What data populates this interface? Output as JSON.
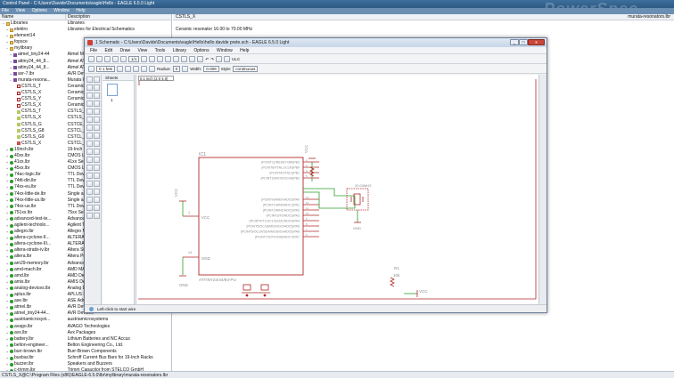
{
  "control_panel": {
    "title": "Control Panel - C:\\Users\\Davide\\Documents\\eagle\\Hello - EAGLE 6.5.0 Light",
    "banner": "PowerSpec",
    "menu": [
      "File",
      "View",
      "Options",
      "Window",
      "Help"
    ],
    "columns": {
      "name": "Name",
      "description": "Description"
    },
    "selected_item": "CSTLS_X",
    "selected_source": "murata-resonators.lbr",
    "selected_description": "Ceramic resonator 16.00 to 70.00 MHz",
    "status": "CSTLS_X@C:\\Program Files (x86)\\EAGLE-6.5.0\\lbr\\mylibrary\\murata-resonators.lbr"
  },
  "tree_rows": [
    {
      "n": "Libraries",
      "d": "Libraries",
      "i": "folder",
      "e": "-"
    },
    {
      "n": "elektro",
      "d": "Libraries for Electrical Schematics",
      "i": "folder",
      "e": "+"
    },
    {
      "n": "element14",
      "d": "",
      "i": "folder",
      "e": "+"
    },
    {
      "n": "fopsce",
      "d": "",
      "i": "folder",
      "e": "+"
    },
    {
      "n": "mylibrary",
      "d": "",
      "i": "folder",
      "e": "-"
    },
    {
      "n": "atmel_tiny24-44",
      "d": "Atmel MC",
      "i": "lib",
      "e": "+"
    },
    {
      "n": "attiny24_44_8...",
      "d": "Atmel ATti",
      "i": "lib",
      "e": "+"
    },
    {
      "n": "attiny24_44_8...",
      "d": "Atmel ATti",
      "i": "lib",
      "e": "+"
    },
    {
      "n": "avr-7.lbr",
      "d": "AVR Devices",
      "i": "lib",
      "e": "+"
    },
    {
      "n": "murata-resona...",
      "d": "Murata Cer",
      "i": "lib",
      "e": "-"
    },
    {
      "n": "CSTLS_T",
      "d": "Ceramic re",
      "i": "dev",
      "e": ""
    },
    {
      "n": "CSTLS_X",
      "d": "Ceramic re",
      "i": "dev",
      "e": ""
    },
    {
      "n": "CSTLS_Y",
      "d": "Ceramic re",
      "i": "dev",
      "e": ""
    },
    {
      "n": "CSTLS_X",
      "d": "Ceramic re",
      "i": "dev",
      "e": ""
    },
    {
      "n": "CSTLS_T",
      "d": "CSTLS_T_B",
      "i": "pkg",
      "e": ""
    },
    {
      "n": "CSTLS_X",
      "d": "CSTLS_X_B",
      "i": "pkg",
      "e": ""
    },
    {
      "n": "CSTLS_G",
      "d": "CSTCE_G",
      "i": "pkg",
      "e": ""
    },
    {
      "n": "CSTLS_G8",
      "d": "CSTCL_G8",
      "i": "pkg",
      "e": ""
    },
    {
      "n": "CSTLS_G9",
      "d": "CSTCL_G9",
      "i": "pkg",
      "e": ""
    },
    {
      "n": "CSTLS_X",
      "d": "CSTCL_X S",
      "i": "sym",
      "e": ""
    },
    {
      "n": "19inch.lbr",
      "d": "19-Inch Sl",
      "i": "dot",
      "e": "+"
    },
    {
      "n": "40xx.lbr",
      "d": "CMOS Logi",
      "i": "dot",
      "e": "+"
    },
    {
      "n": "41xx.lbr",
      "d": "41xx Serie",
      "i": "dot",
      "e": "+"
    },
    {
      "n": "45xx.lbr",
      "d": "CMOS Logi",
      "i": "dot",
      "e": "+"
    },
    {
      "n": "74ac-logic.lbr",
      "d": "TTL Devic",
      "i": "dot",
      "e": "+"
    },
    {
      "n": "74ttl-din.lbr",
      "d": "TTL Devic",
      "i": "dot",
      "e": "+"
    },
    {
      "n": "74xx-eu.lbr",
      "d": "TTL Devic",
      "i": "dot",
      "e": "+"
    },
    {
      "n": "74xx-little-de.lbr",
      "d": "Single and",
      "i": "dot",
      "e": "+"
    },
    {
      "n": "74xx-little-us.lbr",
      "d": "Single and",
      "i": "dot",
      "e": "+"
    },
    {
      "n": "74xx-us.lbr",
      "d": "TTL Devic",
      "i": "dot",
      "e": "+"
    },
    {
      "n": "751xx.lbr",
      "d": "75xx Serie",
      "i": "dot",
      "e": "+"
    },
    {
      "n": "advanced-test-te...",
      "d": "Advanced",
      "i": "dot",
      "e": "+"
    },
    {
      "n": "agilent-technolo...",
      "d": "Agilent Te",
      "i": "dot",
      "e": "+"
    },
    {
      "n": "allegro.lbr",
      "d": "Allegro Mi",
      "i": "dot",
      "e": "+"
    },
    {
      "n": "altera-cyclone-II...",
      "d": "ALTERA Cy",
      "i": "dot",
      "e": "+"
    },
    {
      "n": "altera-cyclone-III...",
      "d": "ALTERA Cy",
      "i": "dot",
      "e": "+"
    },
    {
      "n": "altera-stratix-iv.lbr",
      "d": "Altera Str",
      "i": "dot",
      "e": "+"
    },
    {
      "n": "altera.lbr",
      "d": "Altera Pro",
      "i": "dot",
      "e": "+"
    },
    {
      "n": "am29-memory.lbr",
      "d": "Advanced",
      "i": "dot",
      "e": "+"
    },
    {
      "n": "amd-mach.lbr",
      "d": "AMD MACH",
      "i": "dot",
      "e": "+"
    },
    {
      "n": "amd.lbr",
      "d": "AMD Devic",
      "i": "dot",
      "e": "+"
    },
    {
      "n": "amis.lbr",
      "d": "AMIS Devi",
      "i": "dot",
      "e": "+"
    },
    {
      "n": "analog-devices.lbr",
      "d": "Analog De",
      "i": "dot",
      "e": "+"
    },
    {
      "n": "aplus.lbr",
      "d": "APLUS INT",
      "i": "dot",
      "e": "+"
    },
    {
      "n": "ase.lbr",
      "d": "ASE Advan",
      "i": "dot",
      "e": "+"
    },
    {
      "n": "atmel.lbr",
      "d": "AVR Devic",
      "i": "dot",
      "e": "+"
    },
    {
      "n": "atmel_tiny24-44...",
      "d": "AVR Devices",
      "i": "dot",
      "e": "+"
    },
    {
      "n": "austriamicrosyst...",
      "d": "austriamicrosystems",
      "i": "dot",
      "e": "+"
    },
    {
      "n": "avago.lbr",
      "d": "AVAGO Technologies",
      "i": "dot",
      "e": "+"
    },
    {
      "n": "avx.lbr",
      "d": "Avx Packages",
      "i": "dot",
      "e": "+"
    },
    {
      "n": "battery.lbr",
      "d": "Lithium Batteries and NC Accus",
      "i": "dot",
      "e": "+"
    },
    {
      "n": "belton-engineer...",
      "d": "Belton Engineering Co., Ltd.",
      "i": "dot",
      "e": "+"
    },
    {
      "n": "burr-brown.lbr",
      "d": "Burr-Brown Components",
      "i": "dot",
      "e": "+"
    },
    {
      "n": "busbar.lbr",
      "d": "Schroff Current Bus Bars for 19-Inch Racks",
      "i": "dot",
      "e": "+"
    },
    {
      "n": "buzzer.lbr",
      "d": "Speakers and Buzzers",
      "i": "dot",
      "e": "+"
    },
    {
      "n": "c-trimm.lbr",
      "d": "Trimm Capacitor from STELCO GmbH",
      "i": "dot",
      "e": "+"
    }
  ],
  "schematic_window": {
    "title": "1 Schematic - C:\\Users\\Davide\\Documents\\eagle\\Hello\\hello davide prete.sch - EAGLE 6.5.0 Light",
    "menu": [
      "File",
      "Edit",
      "Draw",
      "View",
      "Tools",
      "Library",
      "Options",
      "Window",
      "Help"
    ],
    "zoom_select": "1/1",
    "net_class": "0 1 fets",
    "radius_label": "Radius:",
    "radius_value": "0",
    "width_label": "Width:",
    "width_value": "0.006",
    "style_label": "Style:",
    "style_value": "continuous",
    "grid_readout": "0.1 inch (2.0 4.0)",
    "sheets_label": "Sheets",
    "sheet_number": "1",
    "status": "Left-click to start wire",
    "close": "x",
    "minimize": "_",
    "maximize": "□",
    "undo_glyph": "↶",
    "redo_glyph": "↷",
    "ulc_label": "ULC"
  },
  "schematic": {
    "ic_name": "IC1",
    "ic_value": "ATTINY24/44/84-PU",
    "vcc_label": "VCC",
    "gnd_label": "GND",
    "pin_vcc": "VCC",
    "pin_gnd": "GND",
    "pin_num_vcc": "1",
    "pin_num_gnd": "14",
    "pins_left": [
      "(PCINT11/RESET/dW)PB3",
      "(PCINT8/XTAL1/CLKI)PB0",
      "(PCINT9/XTAL2)PB1",
      "(PCINT10/INT0/OC0A)PB2",
      "(PCINT0/AREF/ADC0)PA0",
      "(PCINT1/AIN0/ADC1)PA1",
      "(PCINT2/AIN1/ADC2)PA2",
      "(PCINT3/T0/ADC3)PA3",
      "(PCINT4/T1/SCL/USCK/ADC4)PA4",
      "(PCINT5/OC1B/MISO/DO/ADC5)PA5",
      "(PCINT6/OC1A/SDA/MOSI/DI/ADC6)PA6",
      "(PCINT7/ICP/OC0B/ADC7)PA7"
    ],
    "pins_right": [
      "PB3",
      "PB0",
      "PB1",
      "PB2",
      "PA0",
      "PA1",
      "PA2",
      "PA3",
      "PA4",
      "PA5",
      "PA6",
      "PA7"
    ],
    "pins_right_num": [
      "4",
      "2",
      "3",
      "5",
      "13",
      "12",
      "11",
      "10",
      "9",
      "8",
      "7",
      "6"
    ],
    "resonator_label": "20.00MHZ",
    "resonator_name": "Q1",
    "r1_label": "R1",
    "r1_value": "10k",
    "r2_label": "R1",
    "r2_value": "10k",
    "vcc2": "VCC",
    "vcc3": "VCC"
  },
  "colors": {
    "wire": "#2f9e2f",
    "part": "#b02828",
    "text": "#8a8a8a",
    "frame": "#b02828"
  }
}
